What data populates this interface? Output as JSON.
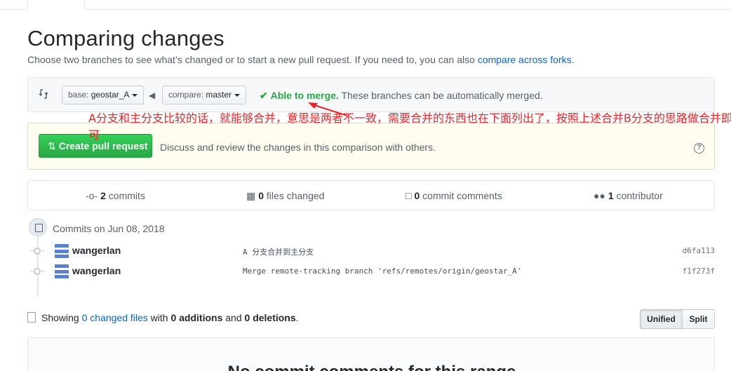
{
  "header": {
    "title": "Comparing changes",
    "subtitle_prefix": "Choose two branches to see what’s changed or to start a new pull request. If you need to, you can also ",
    "subtitle_link": "compare across forks",
    "subtitle_suffix": "."
  },
  "range": {
    "base_prefix": "base: ",
    "base_branch": "geostar_A",
    "compare_prefix": "compare: ",
    "compare_branch": "master",
    "merge_status": "Able to merge.",
    "merge_desc": " These branches can be automatically merged."
  },
  "annotation": {
    "text": "A分支和主分支比较的话，就能够合并，意思是两者不一致，需要合并的东西也在下面列出了，按照上述合并B分支的思路做合并即可",
    "color": "#e8262b"
  },
  "pull_request": {
    "button_label": "Create pull request",
    "description": "Discuss and review the changes in this comparison with others."
  },
  "stats": {
    "commits_count": "2",
    "commits_label": " commits",
    "files_count": "0",
    "files_label": " files changed",
    "comments_count": "0",
    "comments_label": " commit comments",
    "contributors_count": "1",
    "contributors_label": " contributor"
  },
  "commits": {
    "date_header": "Commits on Jun 08, 2018",
    "items": [
      {
        "author": "wangerlan",
        "message": "A 分支合并到主分支",
        "sha": "d6fa113"
      },
      {
        "author": "wangerlan",
        "message": "Merge remote-tracking branch 'refs/remotes/origin/geostar_A'",
        "sha": "f1f273f"
      }
    ]
  },
  "files": {
    "showing": "Showing ",
    "changed_link": "0 changed files",
    "with": " with ",
    "additions": "0 additions",
    "and": " and ",
    "deletions": "0 deletions",
    "period": ".",
    "unified_label": "Unified",
    "split_label": "Split"
  },
  "blank": {
    "heading": "No commit comments for this range"
  },
  "colors": {
    "link": "#0366d6",
    "success": "#28a745",
    "annotation": "#e8262b"
  }
}
